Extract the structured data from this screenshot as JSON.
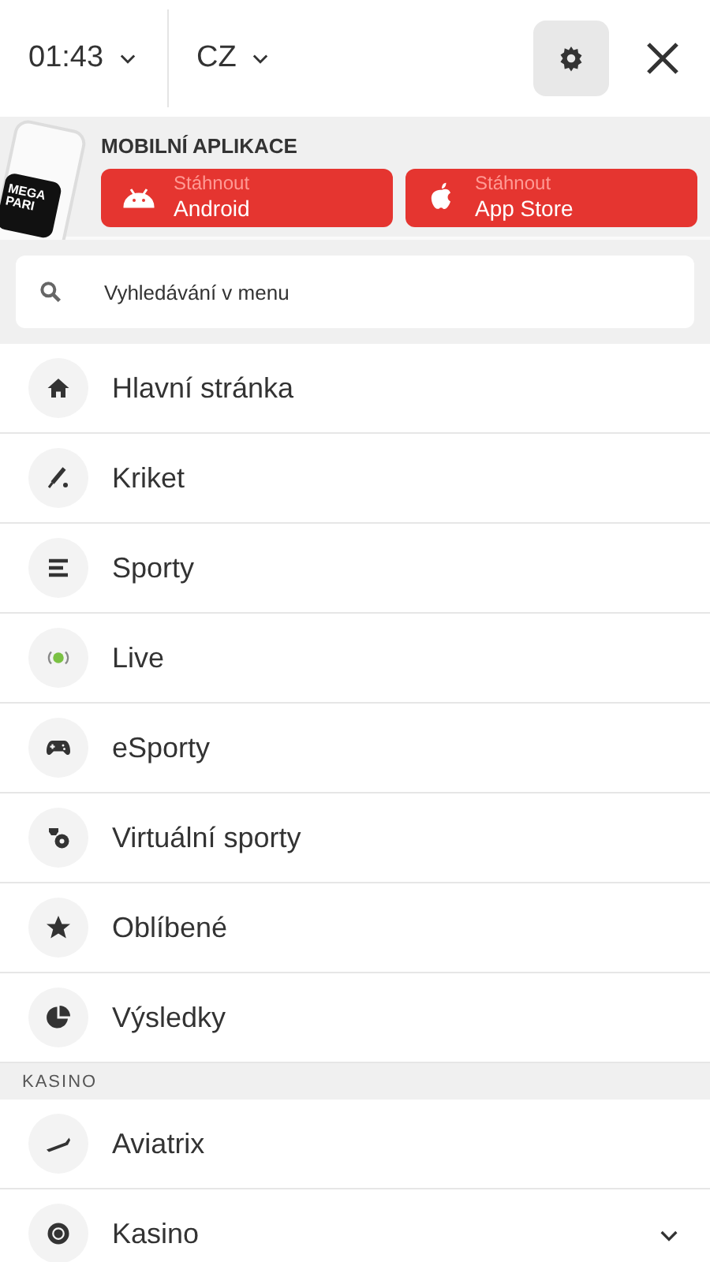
{
  "header": {
    "time": "01:43",
    "language": "CZ"
  },
  "app_banner": {
    "title": "MOBILNÍ APLIKACE",
    "logo": "MEGA PARI",
    "buttons": [
      {
        "kind": "android",
        "caption": "Stáhnout",
        "label": "Android"
      },
      {
        "kind": "apple",
        "caption": "Stáhnout",
        "label": "App Store"
      }
    ]
  },
  "search": {
    "placeholder": "Vyhledávání v menu"
  },
  "sections": [
    {
      "items": [
        {
          "label": "Hlavní stránka"
        },
        {
          "label": "Kriket"
        },
        {
          "label": "Sporty"
        },
        {
          "label": "Live"
        },
        {
          "label": "eSporty"
        },
        {
          "label": "Virtuální sporty"
        },
        {
          "label": "Oblíbené"
        },
        {
          "label": "Výsledky"
        }
      ]
    },
    {
      "heading": "KASINO",
      "items": [
        {
          "label": "Aviatrix"
        },
        {
          "label": "Kasino",
          "expanded": false
        }
      ]
    }
  ]
}
